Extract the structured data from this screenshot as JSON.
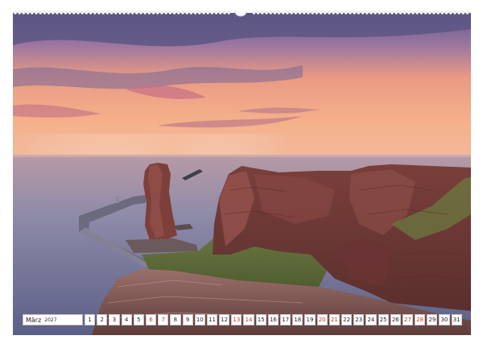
{
  "calendar": {
    "month": "März",
    "year": "2027",
    "days": [
      {
        "label": "1",
        "weekend": false
      },
      {
        "label": "2",
        "weekend": false
      },
      {
        "label": "3",
        "weekend": false
      },
      {
        "label": "4",
        "weekend": false
      },
      {
        "label": "5",
        "weekend": false
      },
      {
        "label": "6",
        "weekend": true
      },
      {
        "label": "7",
        "weekend": true
      },
      {
        "label": "8",
        "weekend": false
      },
      {
        "label": "9",
        "weekend": false
      },
      {
        "label": "10",
        "weekend": false
      },
      {
        "label": "11",
        "weekend": false
      },
      {
        "label": "12",
        "weekend": false
      },
      {
        "label": "13",
        "weekend": true
      },
      {
        "label": "14",
        "weekend": true
      },
      {
        "label": "15",
        "weekend": false
      },
      {
        "label": "16",
        "weekend": false
      },
      {
        "label": "17",
        "weekend": false
      },
      {
        "label": "18",
        "weekend": false
      },
      {
        "label": "19",
        "weekend": false
      },
      {
        "label": "20",
        "weekend": true
      },
      {
        "label": "21",
        "weekend": true
      },
      {
        "label": "22",
        "weekend": false
      },
      {
        "label": "23",
        "weekend": false
      },
      {
        "label": "24",
        "weekend": false
      },
      {
        "label": "25",
        "weekend": false
      },
      {
        "label": "26",
        "weekend": false
      },
      {
        "label": "27",
        "weekend": true
      },
      {
        "label": "28",
        "weekend": true
      },
      {
        "label": "29",
        "weekend": false
      },
      {
        "label": "30",
        "weekend": false
      },
      {
        "label": "31",
        "weekend": false
      }
    ]
  },
  "colors": {
    "weekend": "#c0392b",
    "weekday": "#222222",
    "sky_top": "#6a5f8e",
    "sky_mid": "#f0a07a",
    "horizon": "#f3b28c",
    "sea": "#8a8db0",
    "cliff": "#8a4a44"
  }
}
